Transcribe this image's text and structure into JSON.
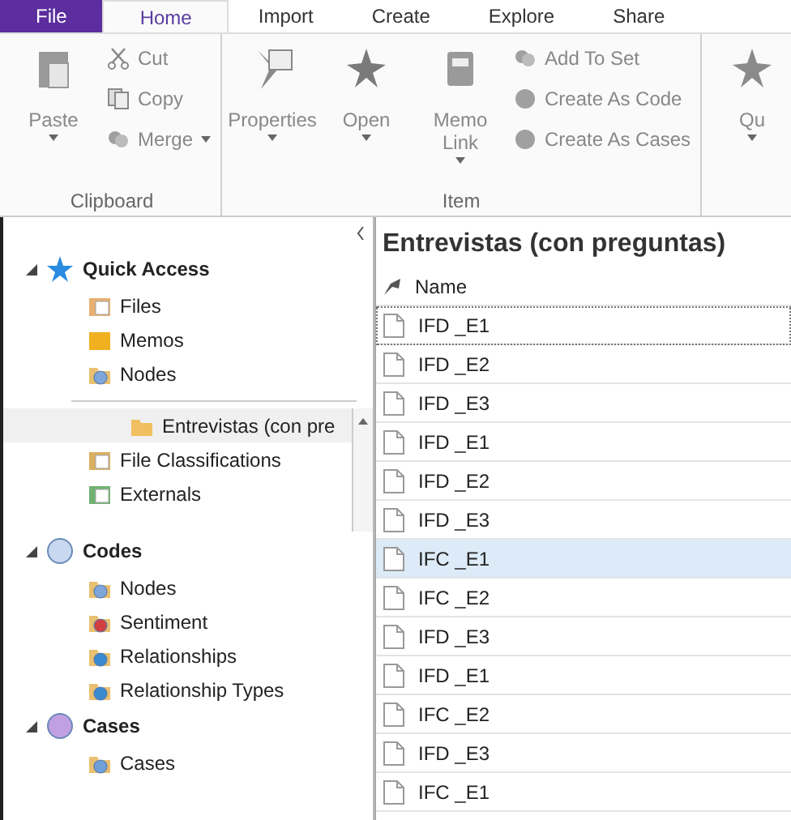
{
  "ribbon": {
    "tabs": [
      {
        "label": "File",
        "kind": "file",
        "selected": false
      },
      {
        "label": "Home",
        "kind": "tab",
        "selected": true
      },
      {
        "label": "Import",
        "kind": "tab",
        "selected": false
      },
      {
        "label": "Create",
        "kind": "tab",
        "selected": false
      },
      {
        "label": "Explore",
        "kind": "tab",
        "selected": false
      },
      {
        "label": "Share",
        "kind": "tab",
        "selected": false
      }
    ],
    "groups": [
      {
        "label": "Clipboard",
        "large": [
          {
            "label": "Paste",
            "dropdown": true
          }
        ],
        "small": [
          {
            "label": "Cut",
            "dropdown": false
          },
          {
            "label": "Copy",
            "dropdown": false
          },
          {
            "label": "Merge",
            "dropdown": true
          }
        ]
      },
      {
        "label": "Item",
        "large": [
          {
            "label": "Properties",
            "dropdown": true
          },
          {
            "label": "Open",
            "dropdown": true
          },
          {
            "label": "Memo Link",
            "dropdown": true
          }
        ],
        "small": [
          {
            "label": "Add To Set",
            "dropdown": false
          },
          {
            "label": "Create As Code",
            "dropdown": false
          },
          {
            "label": "Create As Cases",
            "dropdown": false
          }
        ]
      },
      {
        "large": [
          {
            "label": "Qu",
            "dropdown": true
          }
        ]
      }
    ]
  },
  "sidebar": {
    "sections": [
      {
        "label": "Quick Access",
        "expanded": true,
        "children": [
          {
            "label": "Files"
          },
          {
            "label": "Memos"
          },
          {
            "label": "Nodes"
          }
        ]
      },
      {
        "kind": "data",
        "children": [
          {
            "label": "Entrevistas (con pre",
            "kind": "nested",
            "selected": true
          },
          {
            "label": "File Classifications",
            "kind": "item",
            "selected": false
          },
          {
            "label": "Externals",
            "kind": "item",
            "selected": false
          }
        ]
      },
      {
        "label": "Codes",
        "expanded": true,
        "children": [
          {
            "label": "Nodes"
          },
          {
            "label": "Sentiment"
          },
          {
            "label": "Relationships"
          },
          {
            "label": "Relationship Types"
          }
        ]
      },
      {
        "label": "Cases",
        "expanded": true,
        "children": [
          {
            "label": "Cases"
          }
        ]
      }
    ]
  },
  "content": {
    "title": "Entrevistas (con preguntas)",
    "columns": [
      "Name"
    ],
    "rows": [
      {
        "name": "IFD _E1",
        "selected": false,
        "focused": true
      },
      {
        "name": "IFD _E2",
        "selected": false,
        "focused": false
      },
      {
        "name": "IFD _E3",
        "selected": false,
        "focused": false
      },
      {
        "name": "IFD _E1",
        "selected": false,
        "focused": false
      },
      {
        "name": "IFD _E2",
        "selected": false,
        "focused": false
      },
      {
        "name": "IFD _E3",
        "selected": false,
        "focused": false
      },
      {
        "name": "IFC _E1",
        "selected": true,
        "focused": false
      },
      {
        "name": "IFC _E2",
        "selected": false,
        "focused": false
      },
      {
        "name": "IFD _E3",
        "selected": false,
        "focused": false
      },
      {
        "name": "IFD _E1",
        "selected": false,
        "focused": false
      },
      {
        "name": "IFC _E2",
        "selected": false,
        "focused": false
      },
      {
        "name": "IFD _E3",
        "selected": false,
        "focused": false
      },
      {
        "name": "IFC _E1",
        "selected": false,
        "focused": false
      }
    ]
  }
}
